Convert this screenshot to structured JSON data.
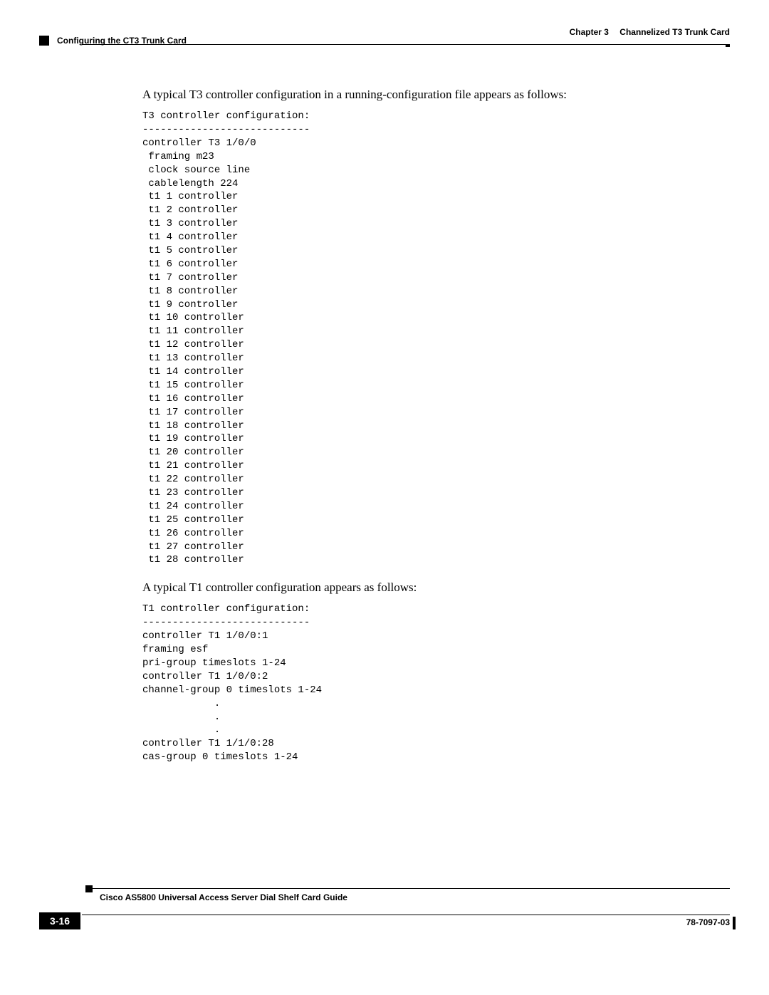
{
  "header": {
    "chapter_label": "Chapter 3",
    "chapter_title": "Channelized T3 Trunk Card",
    "section_title": "Configuring the CT3 Trunk Card"
  },
  "body": {
    "para1": "A typical T3 controller configuration in a running-configuration file appears as follows:",
    "code1": "T3 controller configuration:\n----------------------------\ncontroller T3 1/0/0\n framing m23\n clock source line\n cablelength 224\n t1 1 controller\n t1 2 controller\n t1 3 controller\n t1 4 controller\n t1 5 controller\n t1 6 controller\n t1 7 controller\n t1 8 controller\n t1 9 controller\n t1 10 controller\n t1 11 controller\n t1 12 controller\n t1 13 controller\n t1 14 controller\n t1 15 controller\n t1 16 controller\n t1 17 controller\n t1 18 controller\n t1 19 controller\n t1 20 controller\n t1 21 controller\n t1 22 controller\n t1 23 controller\n t1 24 controller\n t1 25 controller\n t1 26 controller\n t1 27 controller\n t1 28 controller",
    "para2": "A typical T1 controller configuration appears as follows:",
    "code2": "T1 controller configuration:\n----------------------------\ncontroller T1 1/0/0:1\nframing esf\npri-group timeslots 1-24\ncontroller T1 1/0/0:2\nchannel-group 0 timeslots 1-24\n            .\n            .\n            .\ncontroller T1 1/1/0:28\ncas-group 0 timeslots 1-24"
  },
  "footer": {
    "guide_title": "Cisco AS5800 Universal Access Server Dial Shelf Card Guide",
    "page_number": "3-16",
    "doc_number": "78-7097-03"
  }
}
